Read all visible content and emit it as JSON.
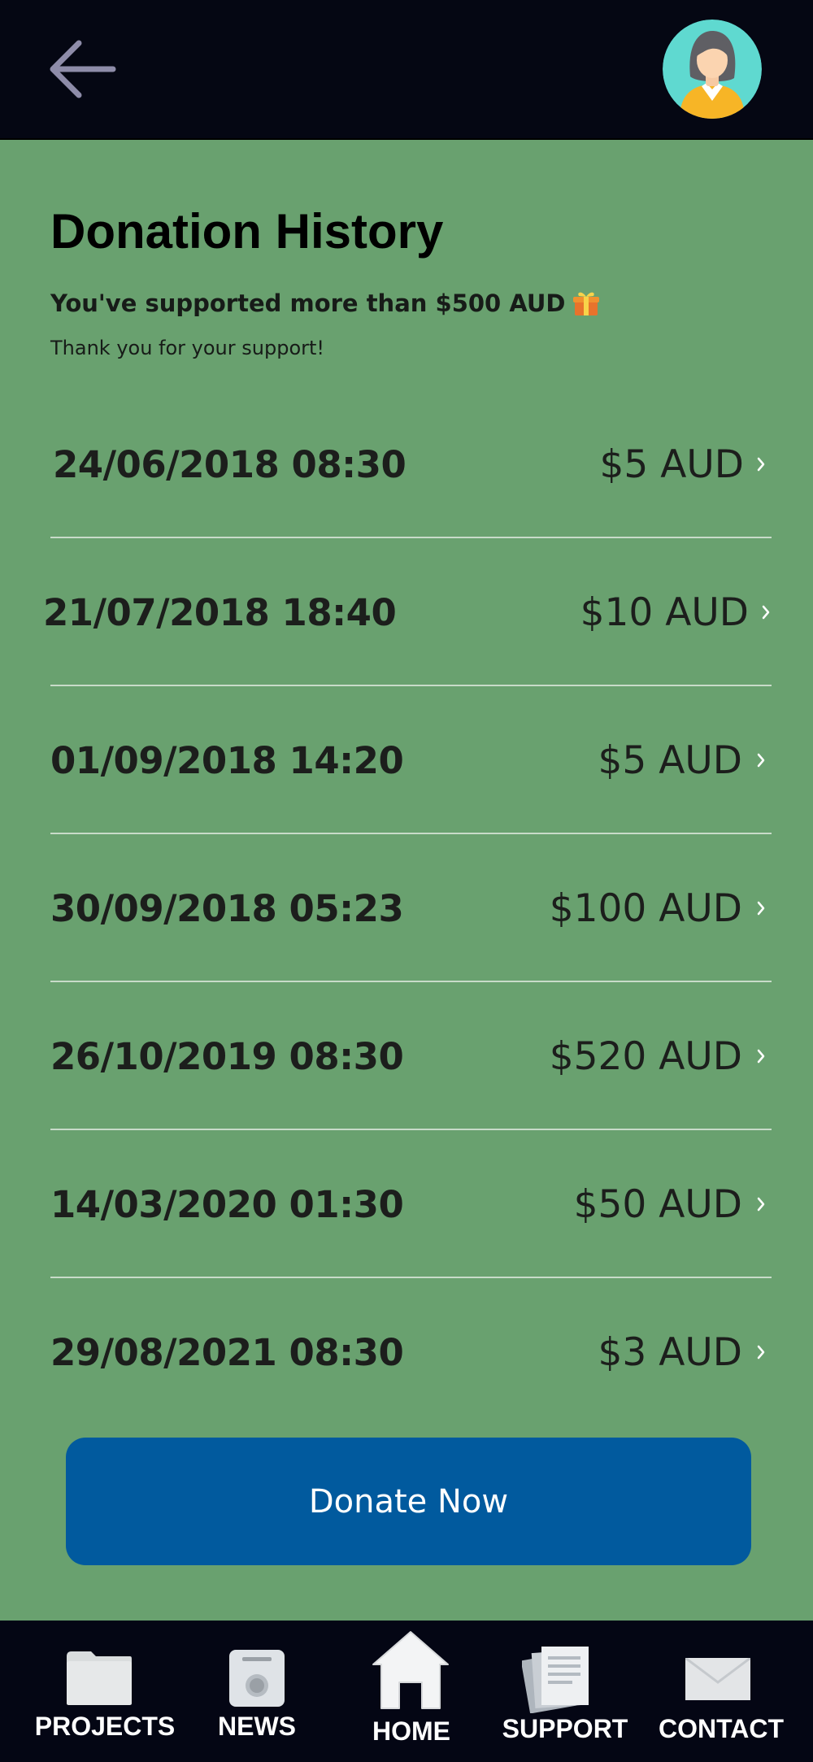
{
  "header": {
    "back_icon": "arrow-left-icon",
    "avatar_icon": "user-avatar-female"
  },
  "page": {
    "title": "Donation History",
    "subtitle": "You've supported more than $500 AUD",
    "subtitle_icon": "gift-icon",
    "thanks": "Thank you for your support!"
  },
  "donations": [
    {
      "date": "24/06/2018 08:30",
      "amount": "$5 AUD"
    },
    {
      "date": "21/07/2018 18:40",
      "amount": "$10 AUD"
    },
    {
      "date": "01/09/2018 14:20",
      "amount": "$5 AUD"
    },
    {
      "date": "30/09/2018 05:23",
      "amount": "$100 AUD"
    },
    {
      "date": "26/10/2019 08:30",
      "amount": "$520 AUD"
    },
    {
      "date": "14/03/2020 01:30",
      "amount": "$50 AUD"
    },
    {
      "date": "29/08/2021 08:30",
      "amount": "$3 AUD"
    }
  ],
  "donate_button": {
    "label": "Donate Now"
  },
  "nav": {
    "items": [
      {
        "label": "PROJECTS",
        "icon": "folder-icon"
      },
      {
        "label": "NEWS",
        "icon": "newspaper-icon"
      },
      {
        "label": "HOME",
        "icon": "home-icon"
      },
      {
        "label": "SUPPORT",
        "icon": "documents-icon"
      },
      {
        "label": "CONTACT",
        "icon": "envelope-icon"
      }
    ]
  },
  "colors": {
    "background": "#69a16f",
    "topbar": "#050713",
    "button": "#015a9e",
    "divider": "#c8dbc9"
  }
}
